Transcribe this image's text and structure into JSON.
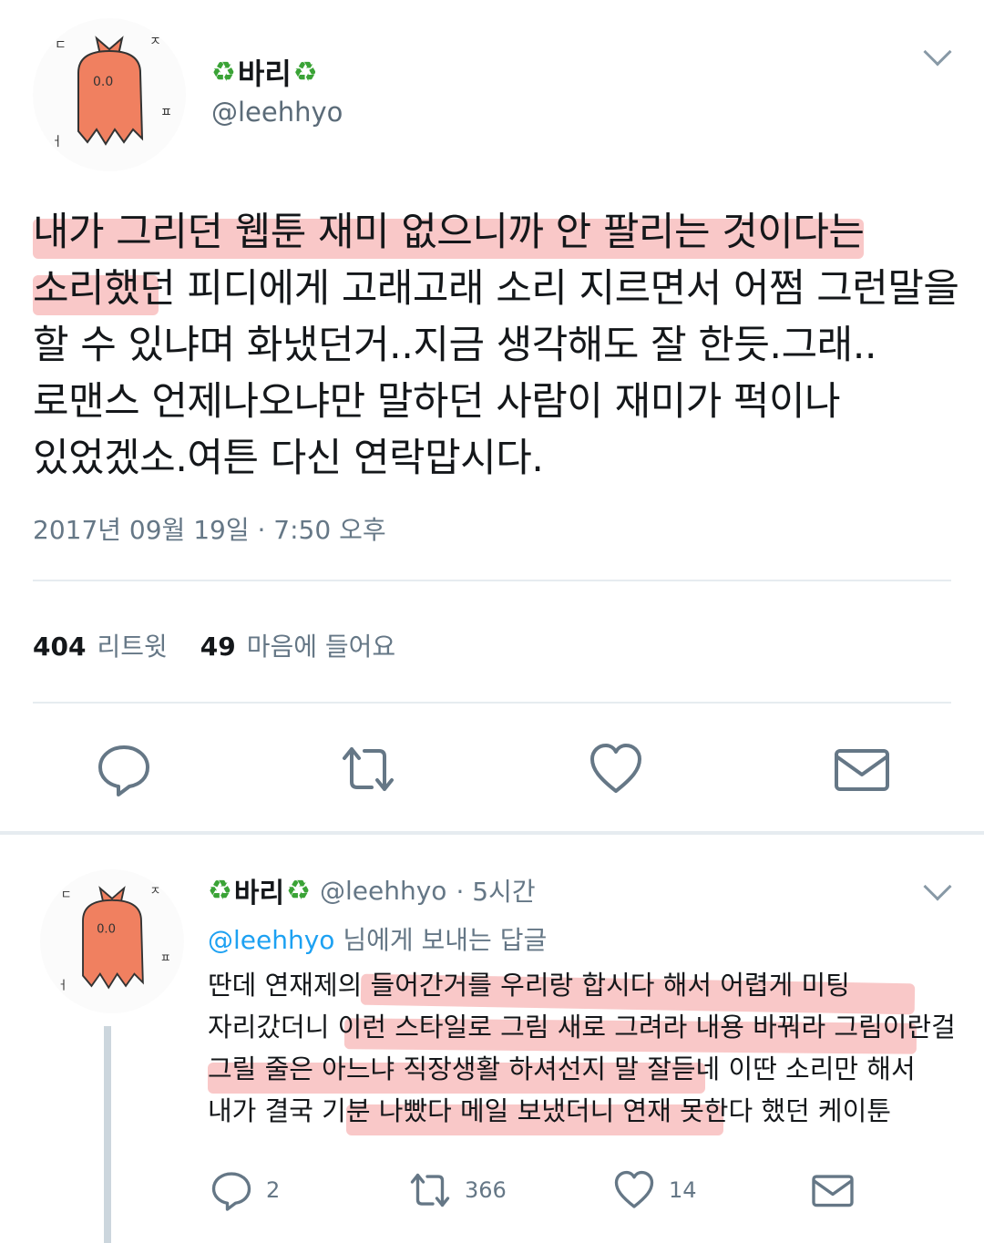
{
  "tweet": {
    "display_name_emoji_left": "♻",
    "display_name": "바리",
    "display_name_emoji_right": "♻",
    "handle": "@leehhyo",
    "text_lines": [
      "내가 그리던 웹툰 재미 없으니까 안 팔리는 것이다는",
      "소리했던 피디에게 고래고래 소리 지르면서 어쩜 그런말을",
      "할 수 있냐며 화냈던거..지금 생각해도 잘 한듯.그래..",
      "로맨스 언제나오냐만 말하던 사람이 재미가 퍽이나",
      "있었겠소.여튼 다신 연락맙시다."
    ],
    "timestamp": "2017년 09월 19일 · 7:50 오후",
    "retweets_count": "404",
    "retweets_label": "리트윗",
    "likes_count": "49",
    "likes_label": "마음에 들어요"
  },
  "reply": {
    "display_name": "바리",
    "handle": "@leehhyo",
    "time": "· 5시간",
    "reply_mention": "@leehhyo",
    "reply_suffix": " 님에게 보내는 답글",
    "text_lines": [
      "딴데 연재제의 들어간거를 우리랑 합시다 해서 어렵게 미팅",
      "자리갔더니 이런 스타일로 그림 새로 그려라 내용 바꿔라 그림이란걸",
      "그릴 줄은 아느냐 직장생활 하셔선지 말 잘듣네 이딴 소리만 해서",
      "내가 결국 기분 나빴다 메일 보냈더니 연재 못한다 했던 케이툰"
    ],
    "reply_count": "2",
    "retweet_count": "366",
    "like_count": "14"
  },
  "icons": {
    "reply": "reply-icon",
    "retweet": "retweet-icon",
    "like": "heart-icon",
    "dm": "envelope-icon",
    "more": "chevron-down-icon"
  },
  "colors": {
    "text": "#14171a",
    "muted": "#657786",
    "mention": "#1da1f2",
    "recycle": "#3aa336",
    "highlight": "#f06e6e"
  }
}
